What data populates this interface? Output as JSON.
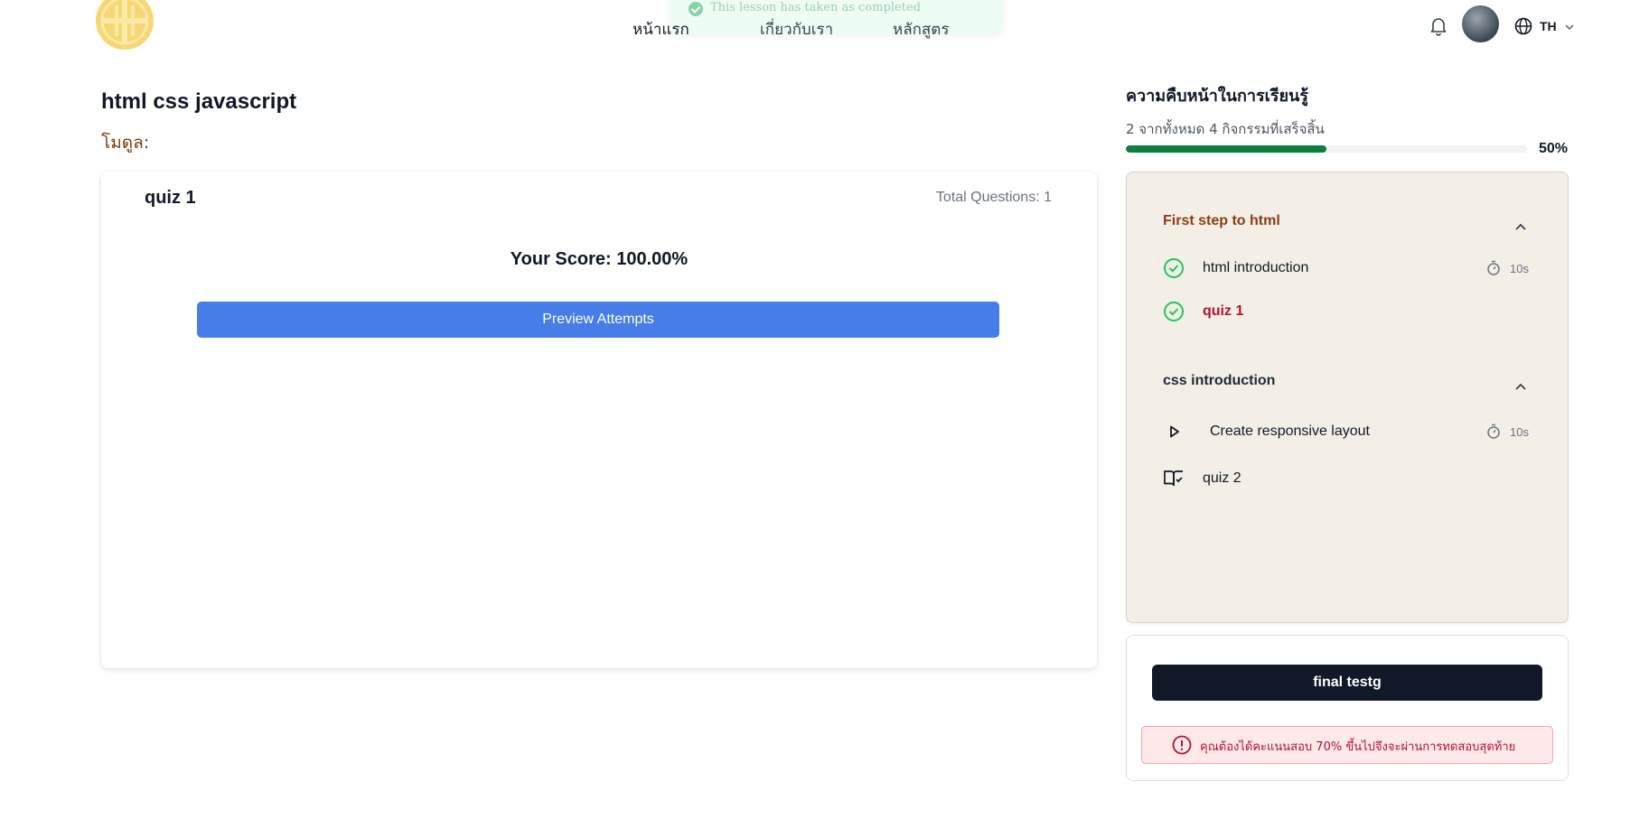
{
  "header": {
    "nav": [
      {
        "label": "หน้าแรก"
      },
      {
        "label": "เกี่ยวกับเรา"
      },
      {
        "label": "หลักสูตร"
      }
    ],
    "toast": "This lesson has taken as completed",
    "language": "TH",
    "icons": {
      "bell": "bell-icon",
      "globe": "globe-icon",
      "chevron": "chevron-down-icon"
    }
  },
  "main": {
    "course_title": "html css javascript",
    "module_label": "โมดูล:",
    "quiz": {
      "title": "quiz 1",
      "total_questions": "Total Questions: 1",
      "score": "Your Score: 100.00%",
      "preview_button": "Preview Attempts"
    }
  },
  "sidebar": {
    "progress_title": "ความคืบหน้าในการเรียนรู้",
    "progress_text": "2 จากทั้งหมด 4 กิจกรรมที่เสร็จสิ้น",
    "progress_percent_label": "50%",
    "progress_fraction": 0.5,
    "sections": [
      {
        "title": "First step to html",
        "items": [
          {
            "label": "html introduction",
            "icon": "check-circle-icon",
            "duration": "10s"
          },
          {
            "label": "quiz 1",
            "icon": "check-circle-icon",
            "active": true
          }
        ]
      },
      {
        "title": "css introduction",
        "items": [
          {
            "label": "Create responsive layout",
            "icon": "play-icon",
            "duration": "10s"
          },
          {
            "label": "quiz 2",
            "icon": "book-check-icon"
          }
        ]
      }
    ],
    "final_button": "final testg",
    "final_warning": "คุณต้องได้คะแนนสอบ 70% ขึ้นไปจึงจะผ่านการทดสอบสุดท้าย"
  },
  "colors": {
    "primary_button": "#467de9",
    "progress_fill": "#0a7f3f",
    "active_item": "#b4122d",
    "section_accent": "#8b3e11",
    "outline_bg": "#f3efe7",
    "dark_button": "#111827"
  }
}
